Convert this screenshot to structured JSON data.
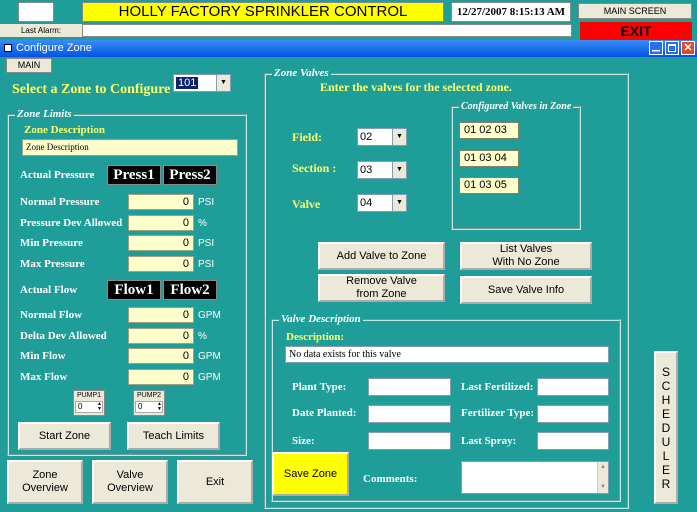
{
  "header": {
    "title": "HOLLY FACTORY SPRINKLER CONTROL",
    "datetime": "12/27/2007  8:15:13 AM",
    "main_screen": "MAIN SCREEN",
    "last_alarm_label": "Last Alarm:",
    "exit": "EXIT"
  },
  "window": {
    "title": "Configure Zone"
  },
  "tab": {
    "main": "MAIN"
  },
  "zone_select": {
    "label": "Select a Zone to Configure",
    "value": "101"
  },
  "zone_limits": {
    "legend": "Zone Limits",
    "desc_label": "Zone Description",
    "desc_value": "Zone Description",
    "actual_pressure": "Actual Pressure",
    "press1": "Press1",
    "press2": "Press2",
    "rows_pressure": [
      {
        "label": "Normal Pressure",
        "value": "0",
        "unit": "PSI"
      },
      {
        "label": "Pressure Dev Allowed",
        "value": "0",
        "unit": "%"
      },
      {
        "label": "Min Pressure",
        "value": "0",
        "unit": "PSI"
      },
      {
        "label": "Max Pressure",
        "value": "0",
        "unit": "PSI"
      }
    ],
    "actual_flow": "Actual Flow",
    "flow1": "Flow1",
    "flow2": "Flow2",
    "rows_flow": [
      {
        "label": "Normal Flow",
        "value": "0",
        "unit": "GPM"
      },
      {
        "label": "Delta Dev Allowed",
        "value": "0",
        "unit": "%"
      },
      {
        "label": "Min Flow",
        "value": "0",
        "unit": "GPM"
      },
      {
        "label": "Max Flow",
        "value": "0",
        "unit": "GPM"
      }
    ],
    "pump1": "PUMP1",
    "pump2": "PUMP2",
    "pump1_value": "0",
    "pump2_value": "0",
    "start_zone": "Start Zone",
    "teach_limits": "Teach Limits"
  },
  "bottom": {
    "zone_overview": "Zone\nOverview",
    "valve_overview": "Valve\nOverview",
    "exit": "Exit"
  },
  "zone_valves": {
    "legend": "Zone Valves",
    "instruction": "Enter the valves for the selected zone.",
    "field_label": "Field:",
    "field_value": "02",
    "section_label": "Section :",
    "section_value": "03",
    "valve_label": "Valve",
    "valve_value": "04",
    "configured_legend": "Configured Valves in Zone",
    "configured": [
      "01 02 03",
      "01 03 04",
      "01 03 05"
    ],
    "add_valve": "Add Valve to Zone",
    "list_valves": "List Valves\nWith No Zone",
    "remove_valve": "Remove Valve\nfrom Zone",
    "save_valve_info": "Save Valve Info"
  },
  "valve_desc": {
    "legend": "Valve Description",
    "desc_label": "Description:",
    "desc_value": "No data exists for this valve",
    "plant_type": "Plant Type:",
    "date_planted": "Date Planted:",
    "size": "Size:",
    "last_fertilized": "Last Fertilized:",
    "fertilizer_type": "Fertilizer Type:",
    "last_spray": "Last Spray:",
    "comments": "Comments:",
    "save_zone": "Save Zone"
  },
  "scheduler": {
    "label": "SCHEDULER"
  },
  "colors": {
    "teal": "#1f9e99",
    "title_yellow": "#ffff00",
    "exit_red": "#ff0000",
    "titlebar_blue": "#0054e3"
  }
}
